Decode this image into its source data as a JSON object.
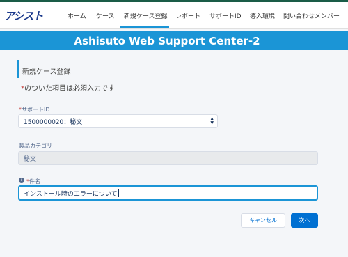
{
  "header": {
    "logo": "アシスト",
    "nav": [
      "ホーム",
      "ケース",
      "新規ケース登録",
      "レポート",
      "サポートID",
      "導入環境",
      "問い合わせメンバー"
    ],
    "active_nav": "新規ケース登録"
  },
  "banner": {
    "title": "Ashisuto Web Support Center-2"
  },
  "form": {
    "section_title": "新規ケース登録",
    "required_mark": "*",
    "required_note": "のついた項目は必須入力です",
    "support_id": {
      "label": "サポートID",
      "value": "1500000020：秘文"
    },
    "product_category": {
      "label": "製品カテゴリ",
      "value": "秘文"
    },
    "subject": {
      "label": "件名",
      "value": "インストール時のエラーについて"
    }
  },
  "buttons": {
    "cancel": "キャンセル",
    "next": "次へ"
  },
  "colors": {
    "brand_blue": "#1b95d6",
    "button_blue": "#0070d2",
    "required_red": "#c23934",
    "logo_navy": "#1b3a8c"
  }
}
